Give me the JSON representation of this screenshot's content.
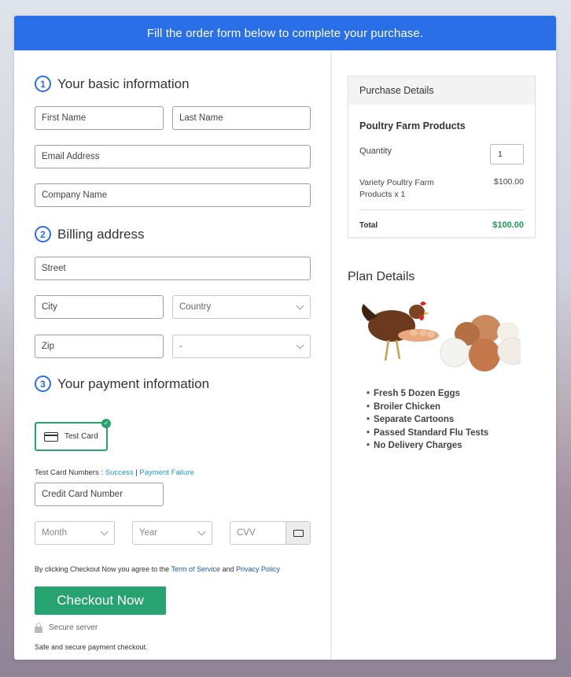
{
  "banner": "Fill the order form below to complete your purchase.",
  "sections": {
    "basic": {
      "num": "1",
      "title": "Your basic information"
    },
    "billing": {
      "num": "2",
      "title": "Billing address"
    },
    "payment": {
      "num": "3",
      "title": "Your payment information"
    }
  },
  "fields": {
    "first_name": "First Name",
    "last_name": "Last Name",
    "email": "Email Address",
    "company": "Company Name",
    "street": "Street",
    "city": "City",
    "country": "Country",
    "zip": "Zip",
    "state": "-",
    "credit_card": "Credit Card Number",
    "month": "Month",
    "year": "Year",
    "cvv": "CVV"
  },
  "payment": {
    "test_card_label": "Test Card",
    "test_numbers_prefix": "Test Card Numbers : ",
    "success": "Success",
    "separator": " | ",
    "failure": "Payment Failure"
  },
  "agreement": {
    "prefix": "By clicking Checkout Now you agree to the ",
    "terms": "Term of Service",
    "and": " and ",
    "privacy": "Privacy Policy"
  },
  "checkout_label": "Checkout Now",
  "secure_label": "Secure server",
  "secure_note": "Safe and secure payment checkout.",
  "purchase": {
    "header": "Purchase Details",
    "product": "Poultry Farm Products",
    "quantity_label": "Quantity",
    "quantity_value": "1",
    "item_name": "Variety Poultry Farm Products x 1",
    "item_price": "$100.00",
    "total_label": "Total",
    "total_value": "$100.00"
  },
  "plan": {
    "title": "Plan Details",
    "features": [
      "Fresh 5 Dozen Eggs",
      "Broiler Chicken",
      "Separate Cartoons",
      "Passed Standard Flu Tests",
      "No Delivery Charges"
    ]
  },
  "colors": {
    "accent": "#2a6fe8",
    "success": "#27a372",
    "total": "#1d9a4e"
  },
  "icons": [
    "credit-card-icon",
    "check-icon",
    "chevron-down-icon",
    "lock-icon"
  ]
}
